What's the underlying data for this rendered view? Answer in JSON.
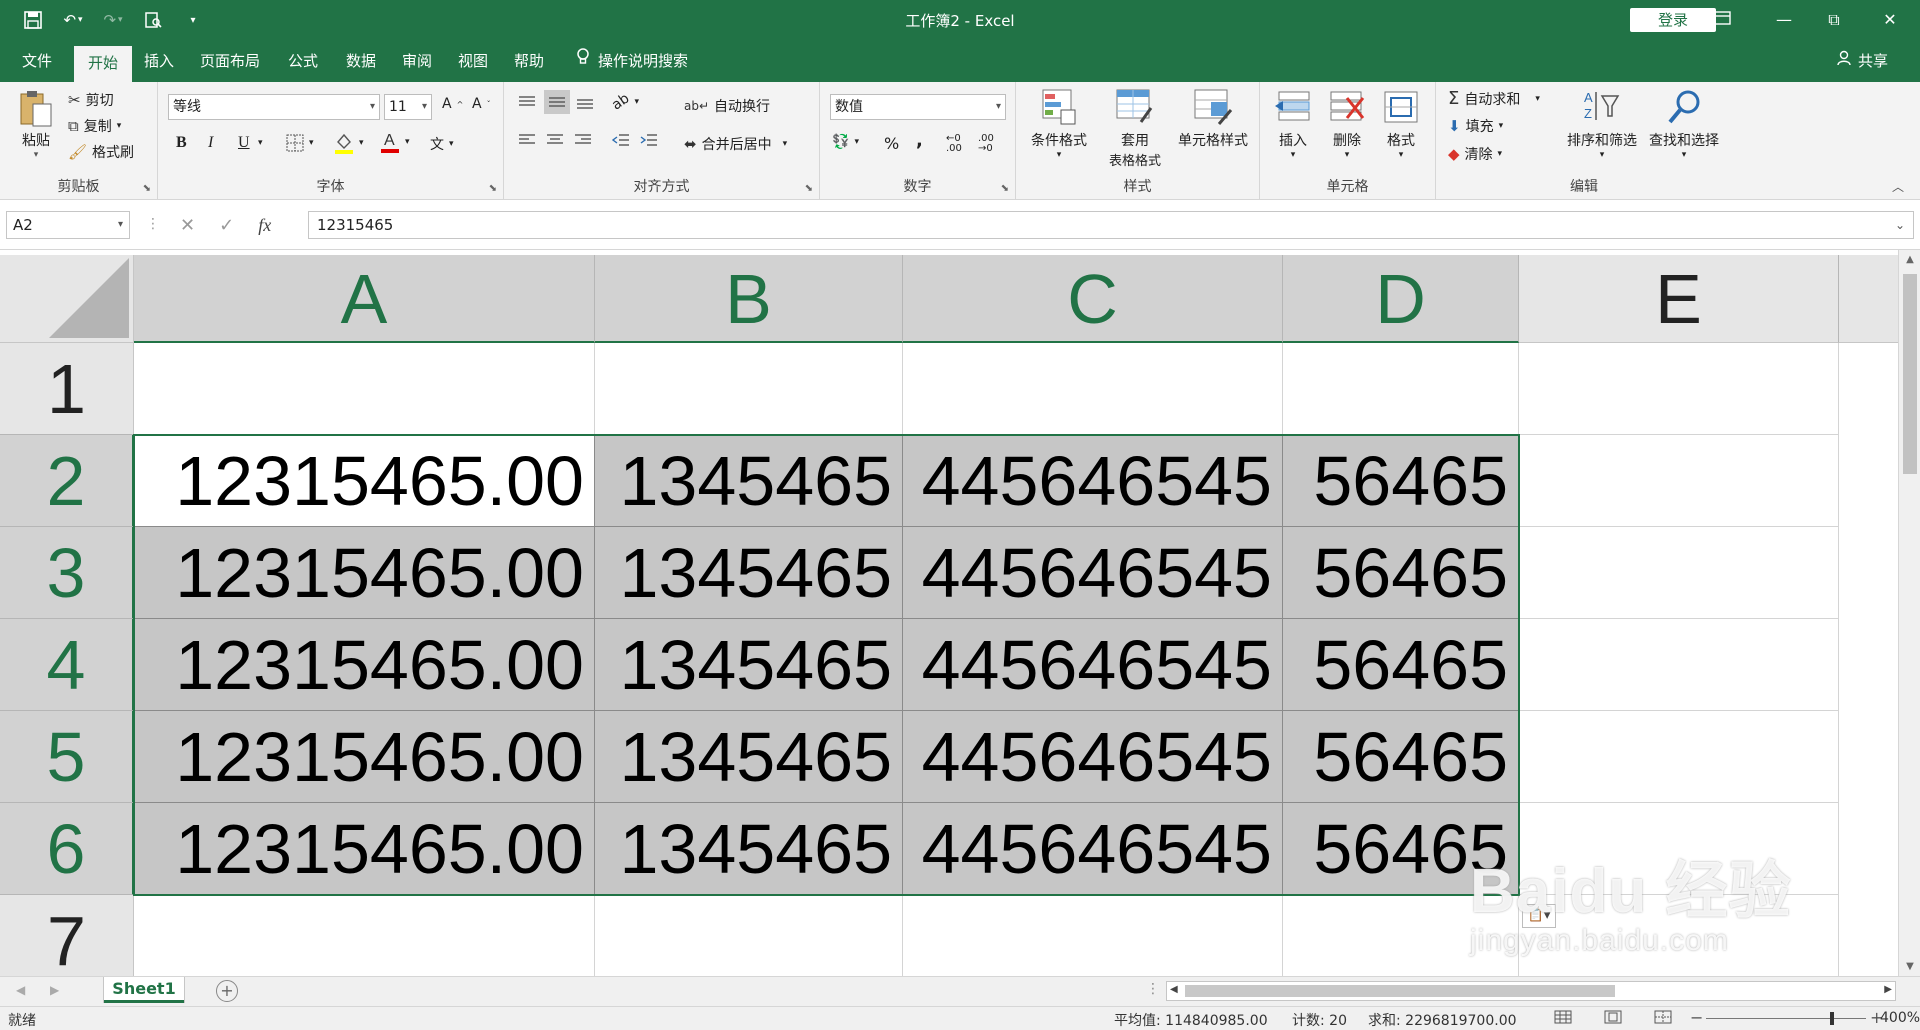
{
  "titlebar": {
    "title": "工作簿2  -  Excel",
    "login": "登录",
    "minimize": "—",
    "restore": "⧉",
    "maximize": "☐",
    "close": "✕"
  },
  "menu": {
    "tabs": [
      "文件",
      "开始",
      "插入",
      "页面布局",
      "公式",
      "数据",
      "审阅",
      "视图",
      "帮助"
    ],
    "active_index": 1,
    "help_search": "操作说明搜索",
    "share": "共享"
  },
  "ribbon": {
    "clipboard": {
      "paste": "粘贴",
      "cut": "剪切",
      "copy": "复制",
      "format_painter": "格式刷",
      "label": "剪贴板"
    },
    "font": {
      "name": "等线",
      "size": "11",
      "bold": "B",
      "italic": "I",
      "underline": "U",
      "label": "字体"
    },
    "alignment": {
      "wrap": "自动换行",
      "merge": "合并后居中",
      "label": "对齐方式"
    },
    "number": {
      "format": "数值",
      "percent": "%",
      "comma": ",",
      "label": "数字"
    },
    "styles": {
      "conditional": "条件格式",
      "table_line1": "套用",
      "table_line2": "表格格式",
      "cell_styles": "单元格样式",
      "label": "样式"
    },
    "cells": {
      "insert": "插入",
      "delete": "删除",
      "format": "格式",
      "label": "单元格"
    },
    "editing": {
      "autosum": "自动求和",
      "fill": "填充",
      "clear": "清除",
      "sort": "排序和筛选",
      "find": "查找和选择",
      "label": "编辑"
    }
  },
  "formula_bar": {
    "name_box": "A2",
    "cancel": "✕",
    "enter": "✓",
    "fx": "fx",
    "value": "12315465"
  },
  "grid": {
    "columns": [
      "A",
      "B",
      "C",
      "D",
      "E"
    ],
    "rows": [
      "1",
      "2",
      "3",
      "4",
      "5",
      "6",
      "7"
    ],
    "cells": [
      [
        "",
        "",
        "",
        "",
        ""
      ],
      [
        "12315465.00",
        "1345465",
        "445646545",
        "56465",
        ""
      ],
      [
        "12315465.00",
        "1345465",
        "445646545",
        "56465",
        ""
      ],
      [
        "12315465.00",
        "1345465",
        "445646545",
        "56465",
        ""
      ],
      [
        "12315465.00",
        "1345465",
        "445646545",
        "56465",
        ""
      ],
      [
        "12315465.00",
        "1345465",
        "445646545",
        "56465",
        ""
      ],
      [
        "",
        "",
        "",
        "",
        ""
      ]
    ]
  },
  "sheets": {
    "tabs": [
      "Sheet1"
    ],
    "active": "Sheet1",
    "add": "+"
  },
  "status": {
    "ready": "就绪",
    "average": "平均值: 114840985.00",
    "count": "计数: 20",
    "sum": "求和: 2296819700.00",
    "zoom": "400%"
  },
  "watermark": {
    "line1": "Baidu 经验",
    "line2": "jingyan.baidu.com"
  },
  "colors": {
    "accent": "#217346",
    "selection": "#c6c6c6",
    "ribbon_bg": "#f3f3f3"
  }
}
